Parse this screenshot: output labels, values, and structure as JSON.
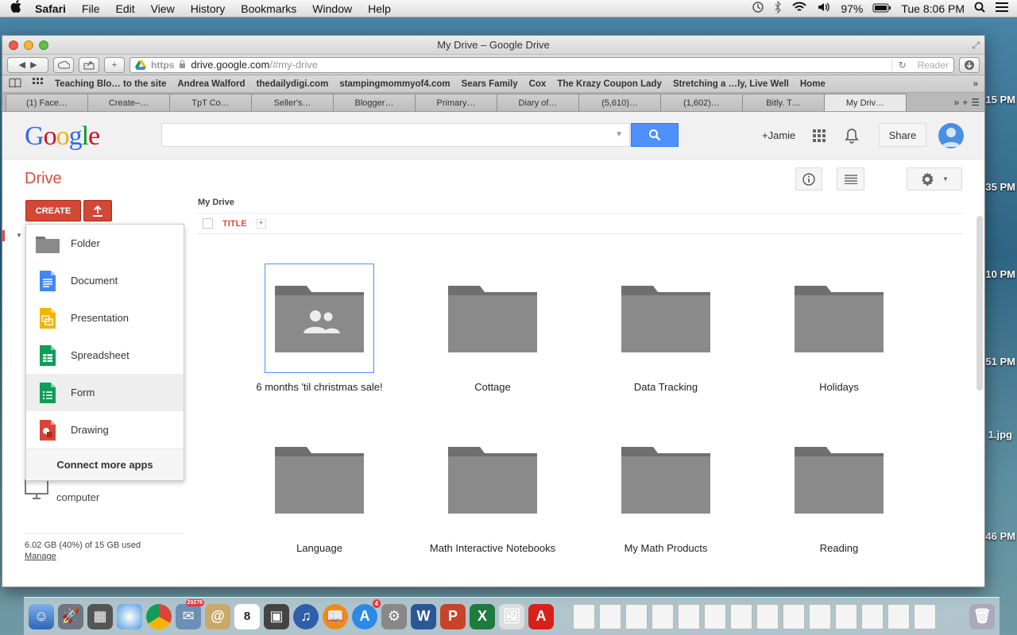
{
  "menubar": {
    "app": "Safari",
    "items": [
      "File",
      "Edit",
      "View",
      "History",
      "Bookmarks",
      "Window",
      "Help"
    ],
    "battery": "97%",
    "clock": "Tue 8:06 PM"
  },
  "desktop": {
    "labels": [
      "15 PM",
      "35 PM",
      "10 PM",
      "51 PM",
      "1.jpg",
      "46 PM"
    ]
  },
  "window": {
    "title": "My Drive – Google Drive"
  },
  "toolbar": {
    "scheme": "https",
    "host": "drive.google.com",
    "path": "/#my-drive",
    "reader": "Reader"
  },
  "bookmarks": [
    "Teaching Blo… to the site",
    "Andrea Walford",
    "thedailydigi.com",
    "stampingmommyof4.com",
    "Sears Family",
    "Cox",
    "The Krazy Coupon Lady",
    "Stretching a …ly, Live Well",
    "Home"
  ],
  "tabs": [
    "(1) Face…",
    "Create–…",
    "TpT Co…",
    "Seller's…",
    "Blogger…",
    "Primary…",
    "Diary of…",
    "(5,610)…",
    "(1,602)…",
    "Bitly. T…",
    "My Driv…"
  ],
  "google": {
    "logo": [
      "G",
      "o",
      "o",
      "g",
      "l",
      "e"
    ],
    "user": "+Jamie",
    "share": "Share"
  },
  "drive": {
    "title": "Drive",
    "create": "CREATE",
    "breadcrumb": "My Drive",
    "title_column": "TITLE",
    "create_menu": [
      {
        "label": "Folder",
        "icon": "folder-icon"
      },
      {
        "label": "Document",
        "icon": "document-icon"
      },
      {
        "label": "Presentation",
        "icon": "presentation-icon"
      },
      {
        "label": "Spreadsheet",
        "icon": "spreadsheet-icon"
      },
      {
        "label": "Form",
        "icon": "form-icon"
      },
      {
        "label": "Drawing",
        "icon": "drawing-icon"
      }
    ],
    "connect_more": "Connect more apps",
    "computer_label": "computer",
    "storage": "6.02 GB (40%) of 15 GB used",
    "manage": "Manage",
    "folders": [
      {
        "name": "6 months 'til christmas sale!",
        "shared": true
      },
      {
        "name": "Cottage",
        "shared": false
      },
      {
        "name": "Data Tracking",
        "shared": false
      },
      {
        "name": "Holidays",
        "shared": false
      },
      {
        "name": "Language",
        "shared": false
      },
      {
        "name": "Math Interactive Notebooks",
        "shared": false
      },
      {
        "name": "My Math Products",
        "shared": false
      },
      {
        "name": "Reading",
        "shared": false
      }
    ]
  },
  "colors": {
    "accent_red": "#dd4b39",
    "create_red": "#d14836",
    "search_blue": "#4d90fe",
    "folder_gray": "#8a8a8a"
  },
  "dock": {
    "mail_badge": "29276",
    "calendar_day": "8",
    "appstore_badge": "4"
  }
}
